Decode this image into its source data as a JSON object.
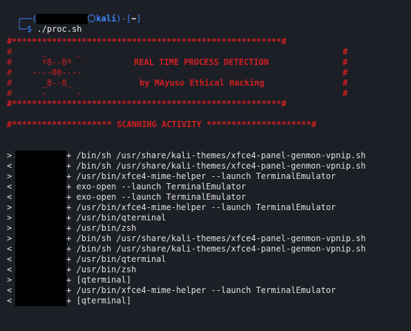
{
  "prompt": {
    "top_prefix": "┌──(",
    "user": "kali",
    "sep": ")-[",
    "dir": "~",
    "close": "]",
    "bottom_prefix": "└─$",
    "command": "./proc.sh"
  },
  "banner": {
    "border": "#******************************************************#",
    "logo_lines": [
      "#      _      _",
      "#      º8--8º",
      "#    ----00----",
      "#      _8--8_",
      "#      -      -"
    ],
    "title": "REAL TIME PROCESS DETECTION",
    "subtitle": "by MAyuso Ethical Hacking",
    "right_hash": "#"
  },
  "scanning_header": "#******************** SCANNING ACTIVITY *********************#",
  "process_rows": [
    {
      "dir": ">",
      "sep": "+",
      "cmd": "/bin/sh /usr/share/kali-themes/xfce4-panel-genmon-vpnip.sh"
    },
    {
      "dir": "<",
      "sep": "+",
      "cmd": "/bin/sh /usr/share/kali-themes/xfce4-panel-genmon-vpnip.sh"
    },
    {
      "dir": ">",
      "sep": "+",
      "cmd": "/usr/bin/xfce4-mime-helper --launch TerminalEmulator"
    },
    {
      "dir": "<",
      "sep": "+",
      "cmd": "exo-open --launch TerminalEmulator"
    },
    {
      "dir": "<",
      "sep": "+",
      "cmd": "exo-open --launch TerminalEmulator"
    },
    {
      "dir": ">",
      "sep": "+",
      "cmd": "/usr/bin/xfce4-mime-helper --launch TerminalEmulator"
    },
    {
      "dir": ">",
      "sep": "+",
      "cmd": "/usr/bin/qterminal"
    },
    {
      "dir": ">",
      "sep": "+",
      "cmd": "/usr/bin/zsh"
    },
    {
      "dir": ">",
      "sep": "+",
      "cmd": "/bin/sh /usr/share/kali-themes/xfce4-panel-genmon-vpnip.sh"
    },
    {
      "dir": "<",
      "sep": "+",
      "cmd": "/bin/sh /usr/share/kali-themes/xfce4-panel-genmon-vpnip.sh"
    },
    {
      "dir": "<",
      "sep": "+",
      "cmd": "/usr/bin/qterminal"
    },
    {
      "dir": "<",
      "sep": "+",
      "cmd": "/usr/bin/zsh"
    },
    {
      "dir": ">",
      "sep": "+",
      "cmd": "[qterminal]"
    },
    {
      "dir": "<",
      "sep": "+",
      "cmd": "/usr/bin/xfce4-mime-helper --launch TerminalEmulator"
    },
    {
      "dir": "<",
      "sep": "+",
      "cmd": "[qterminal]"
    }
  ],
  "colors": {
    "background": "#1d1f27",
    "prompt_blue": "#3a86ff",
    "banner_red": "#d21f1f",
    "text": "#e0e0e0"
  }
}
